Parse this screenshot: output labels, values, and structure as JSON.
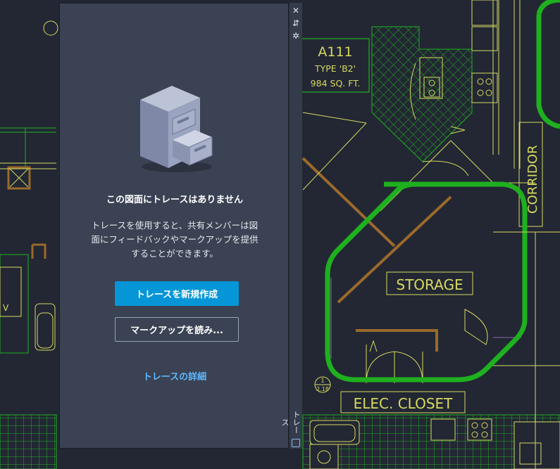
{
  "drawing": {
    "room_name": "A111",
    "room_type": "TYPE 'B2'",
    "room_area": "984 SQ. FT.",
    "storage_label": "STORAGE",
    "corridor_label": "CORRIDOR",
    "closet_label": "ELEC. CLOSET",
    "section_tag_number": "1",
    "section_tag_sheet": "2.18",
    "left_tag_letter": "V"
  },
  "panel": {
    "empty_title": "この図面にトレースはありません",
    "description": "トレースを使用すると、共有メンバーは図面にフィードバックやマークアップを提供することができます。",
    "create_button": "トレースを新規作成",
    "import_button": "マークアップを読み...",
    "details_link": "トレースの詳細"
  },
  "strip": {
    "close_icon": "close-icon",
    "pin_icon": "pin-icon",
    "settings_icon": "settings-icon",
    "tab_label": "トレース"
  },
  "colors": {
    "background": "#222733",
    "panel": "#3a4253",
    "accent": "#0696d7",
    "link": "#5fb8ff",
    "markup_green": "#1fb01f",
    "cad_yellow": "#d8d860",
    "cad_green": "#1fb01f",
    "cad_brown": "#9a6a2a",
    "cad_purple": "#8a6aa8"
  }
}
